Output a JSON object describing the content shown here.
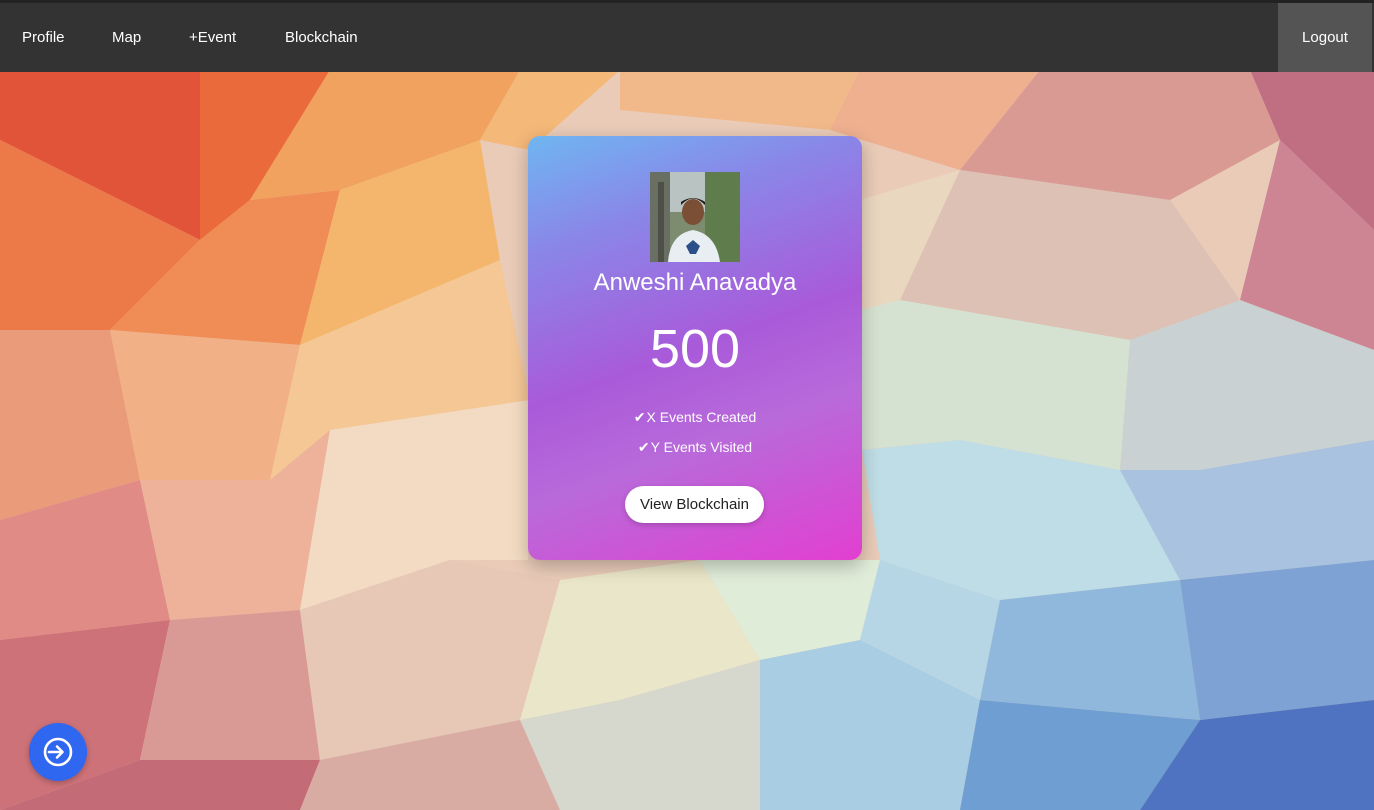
{
  "nav": {
    "links": [
      "Profile",
      "Map",
      "+Event",
      "Blockchain"
    ],
    "logout_label": "Logout"
  },
  "profile_card": {
    "name": "Anweshi Anavadya",
    "score": "500",
    "stats": [
      "X Events Created",
      "Y Events Visited"
    ],
    "button_label": "View Blockchain"
  },
  "icons": {
    "check": "check-icon",
    "fab": "login-arrow-icon"
  },
  "colors": {
    "navbar": "#333333",
    "logout_bg": "#555454",
    "card_gradient_start": "#6fb6f1",
    "card_gradient_mid": "#a95ad9",
    "card_gradient_end": "#e23fd0",
    "fab": "#2f67f0"
  }
}
